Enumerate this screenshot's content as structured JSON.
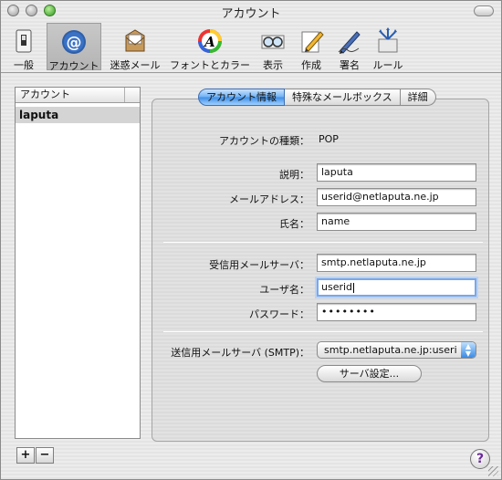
{
  "window": {
    "title": "アカウント"
  },
  "toolbar": {
    "items": [
      {
        "label": "一般",
        "icon": "switch-icon"
      },
      {
        "label": "アカウント",
        "icon": "at-icon"
      },
      {
        "label": "迷惑メール",
        "icon": "junk-mail-icon"
      },
      {
        "label": "フォントとカラー",
        "icon": "font-color-icon"
      },
      {
        "label": "表示",
        "icon": "glasses-icon"
      },
      {
        "label": "作成",
        "icon": "pencil-icon"
      },
      {
        "label": "署名",
        "icon": "pen-icon"
      },
      {
        "label": "ルール",
        "icon": "rules-icon"
      }
    ],
    "active": "アカウント"
  },
  "accounts": {
    "header": "アカウント",
    "items": [
      "laputa"
    ],
    "add_label": "+",
    "remove_label": "−"
  },
  "tabs": [
    "アカウント情報",
    "特殊なメールボックス",
    "詳細"
  ],
  "form": {
    "type_label": "アカウントの種類：",
    "type_value": "POP",
    "desc_label": "説明：",
    "desc_value": "laputa",
    "email_label": "メールアドレス：",
    "email_value": "userid@netlaputa.ne.jp",
    "name_label": "氏名：",
    "name_value": "name",
    "incoming_label": "受信用メールサーバ：",
    "incoming_value": "smtp.netlaputa.ne.jp",
    "user_label": "ユーザ名：",
    "user_value": "userid",
    "password_label": "パスワード：",
    "password_value": "••••••••",
    "smtp_label": "送信用メールサーバ (SMTP)：",
    "smtp_value": "smtp.netlaputa.ne.jp:useri",
    "server_settings_button": "サーバ設定..."
  },
  "help": "?"
}
